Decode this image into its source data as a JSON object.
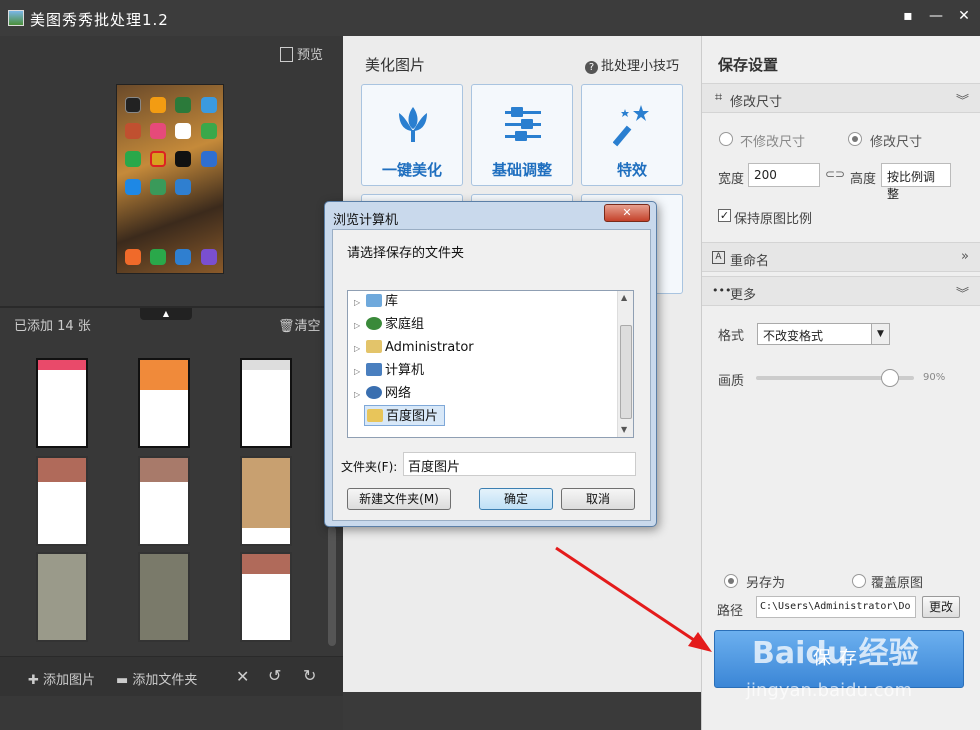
{
  "window": {
    "title": "美图秀秀批处理1.2",
    "feedback_icon": "comment-icon",
    "minimize_label": "—",
    "close_label": "✕"
  },
  "left": {
    "preview_label": "预览",
    "added_count": "已添加 14 张",
    "clear_label": "清空",
    "add_image_label": "添加图片",
    "add_folder_label": "添加文件夹"
  },
  "center": {
    "title": "美化图片",
    "tips_label": "批处理小技巧",
    "tools": [
      {
        "label": "一键美化",
        "icon": "tulip-icon"
      },
      {
        "label": "基础调整",
        "icon": "sliders-icon"
      },
      {
        "label": "特效",
        "icon": "magic-wand-icon"
      }
    ]
  },
  "right": {
    "title": "保存设置",
    "resize_section": "修改尺寸",
    "no_resize_label": "不修改尺寸",
    "resize_label": "修改尺寸",
    "width_label": "宽度",
    "width_value": "200",
    "height_label": "高度",
    "height_value": "按比例调整",
    "keep_ratio_label": "保持原图比例",
    "rename_section": "重命名",
    "more_section": "更多",
    "format_label": "格式",
    "format_value": "不改变格式",
    "quality_label": "画质",
    "quality_value": "90%",
    "quality_level": 0.9,
    "save_as_label": "另存为",
    "overwrite_label": "覆盖原图",
    "path_label": "路径",
    "path_value": "C:\\Users\\Administrator\\Do",
    "change_label": "更改",
    "save_label": "保存"
  },
  "dialog": {
    "title": "浏览计算机",
    "close_label": "✕",
    "prompt": "请选择保存的文件夹",
    "tree": [
      {
        "label": "库",
        "icon": "library-folder-icon",
        "color": "#6fa9dc"
      },
      {
        "label": "家庭组",
        "icon": "homegroup-icon",
        "color": "#3a8a3a"
      },
      {
        "label": "Administrator",
        "icon": "user-folder-icon",
        "color": "#e3c46a"
      },
      {
        "label": "计算机",
        "icon": "computer-icon",
        "color": "#4a7fbf"
      },
      {
        "label": "网络",
        "icon": "network-icon",
        "color": "#3a6fb0"
      },
      {
        "label": "百度图片",
        "icon": "folder-icon",
        "color": "#e8c55a"
      }
    ],
    "folder_label": "文件夹(F):",
    "folder_value": "百度图片",
    "new_folder_label": "新建文件夹(M)",
    "ok_label": "确定",
    "cancel_label": "取消"
  },
  "watermark": {
    "brand": "Baidu 经验",
    "url": "jingyan.baidu.com"
  }
}
